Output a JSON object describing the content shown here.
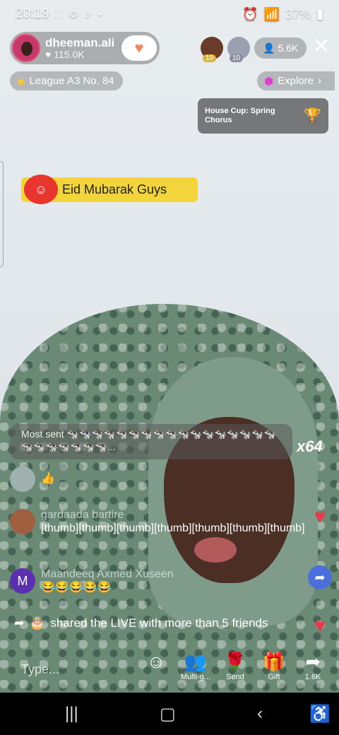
{
  "status_bar": {
    "time": "20:19",
    "left_icons": "⛶ ❂ ♪ •",
    "battery": "37%"
  },
  "host": {
    "username": "dheeman.ali",
    "likes": "115.0K"
  },
  "viewers": {
    "badge_1": "10",
    "badge_2": "10",
    "count": "5.6K"
  },
  "league": "League A3 No. 84",
  "explore": "Explore",
  "house_cup": "House Cup: Spring Chorus",
  "sticker": "Eid Mubarak  Guys",
  "most_sent": {
    "label": "Most sent",
    "gifts": "🐄🐄🐄🐄🐄🐄🐄🐄🐄🐄🐄🐄🐄🐄🐄🐄🐄🐄🐄🐄🐄🐄🐄🐄...",
    "multiplier": "x64"
  },
  "comments": [
    {
      "user": "",
      "text": "👍"
    },
    {
      "user": "gardaada bartire",
      "text": "[thumb][thumb][thumb][thumb][thumb][thumb][thumb]"
    },
    {
      "user": "Maandeeq Axmed Xuseen",
      "initial": "M",
      "text": "😂😂😂😂😂"
    }
  ],
  "shared": "shared the LIVE with more than 5 friends",
  "bottom": {
    "type_placeholder": "Type...",
    "multi_guest": "Multi-g...",
    "send": "Send",
    "gift": "Gift",
    "share_count": "1.6K"
  },
  "colors": {
    "accent_red": "#e83a4d",
    "sticker_yellow": "#f4d43b",
    "host_avatar": "#c63a6b"
  }
}
